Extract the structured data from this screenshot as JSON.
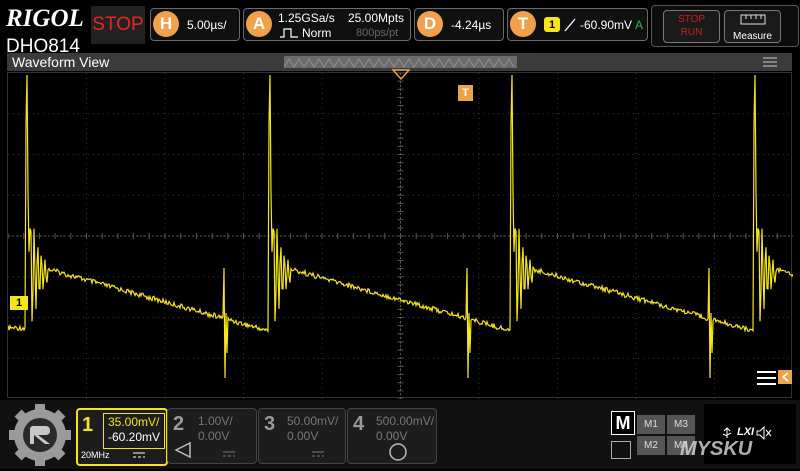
{
  "header": {
    "brand": "RIGOL",
    "run_state": "STOP",
    "model": "DHO814"
  },
  "horizontal": {
    "letter": "H",
    "timebase": "5.00µs/"
  },
  "acquisition": {
    "letter": "A",
    "sample_rate": "1.25GSa/s",
    "memory_depth": "25.00Mpts",
    "mode": "Norm",
    "points_info": "800ps/pt"
  },
  "delay": {
    "letter": "D",
    "value": "-4.24µs"
  },
  "trigger": {
    "letter": "T",
    "source": "1",
    "level": "-60.90mV",
    "sweep": "A"
  },
  "controls": {
    "run_stop_top": "STOP",
    "run_stop_bottom": "RUN",
    "measure_label": "Measure"
  },
  "waveform_view": {
    "title": "Waveform View",
    "trigger_marker": "T",
    "ch1_marker": "1"
  },
  "channels": [
    {
      "num": "1",
      "scale": "35.00mV/",
      "offset": "-60.20mV",
      "bandwidth": "20MHz",
      "color": "#f5e51b",
      "active": true
    },
    {
      "num": "2",
      "scale": "1.00V/",
      "offset": "0.00V",
      "color": "#8a8a8a",
      "active": false
    },
    {
      "num": "3",
      "scale": "50.00mV/",
      "offset": "0.00V",
      "color": "#8a8a8a",
      "active": false
    },
    {
      "num": "4",
      "scale": "500.00mV/",
      "offset": "0.00V",
      "color": "#8a8a8a",
      "active": false
    }
  ],
  "math": {
    "label": "M",
    "buttons": [
      "M1",
      "M3",
      "M2",
      "M4"
    ]
  },
  "status": {
    "lxi": "LXI"
  },
  "watermark": "MYSKU",
  "colors": {
    "accent": "#f0a14a",
    "ch1": "#f5e51b",
    "stop": "#e32626"
  }
}
